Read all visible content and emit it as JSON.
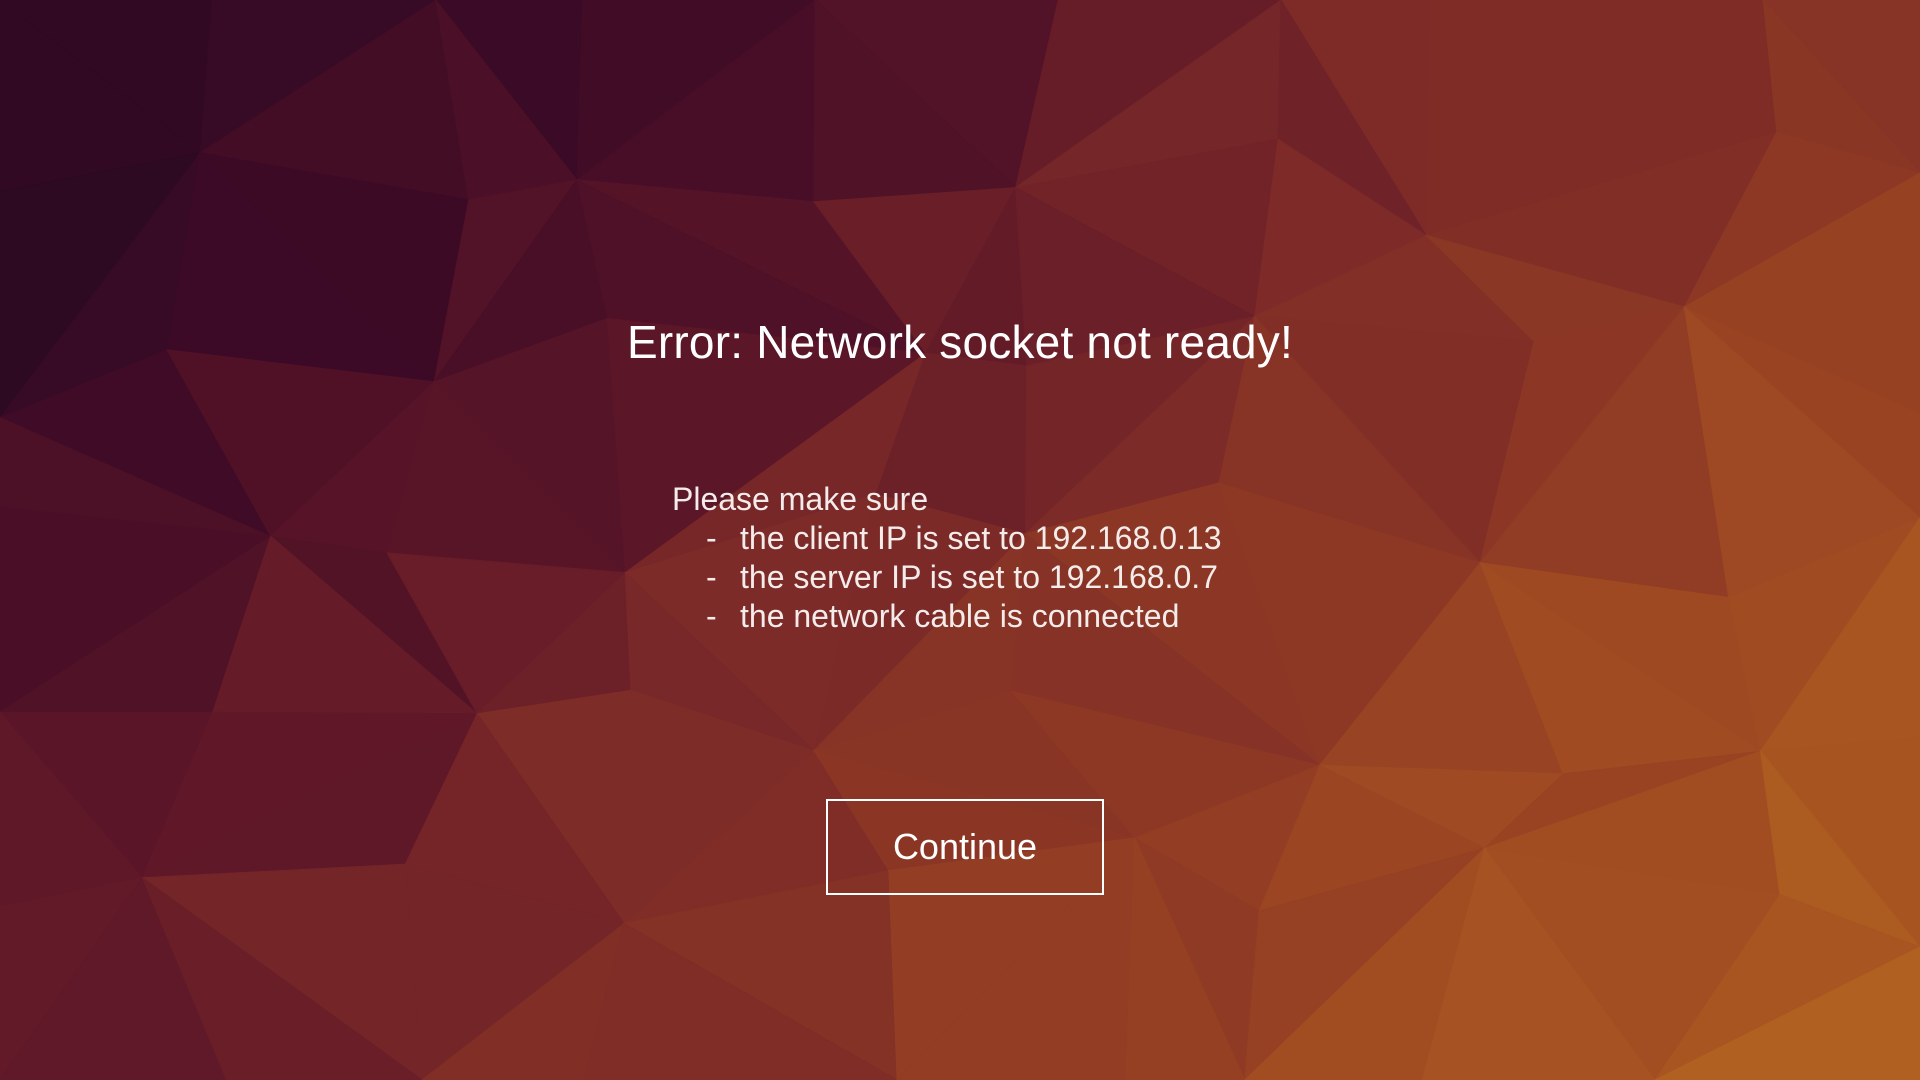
{
  "dialog": {
    "title": "Error: Network socket not ready!",
    "intro": "Please make sure",
    "bullet_marker": "-",
    "checks": [
      "the client IP is set to 192.168.0.13",
      "the server IP is set to 192.168.0.7",
      "the network cable is connected"
    ],
    "continue_label": "Continue"
  },
  "colors": {
    "text": "#ffffff",
    "background_dark": "#250820",
    "background_light": "#b06020"
  }
}
